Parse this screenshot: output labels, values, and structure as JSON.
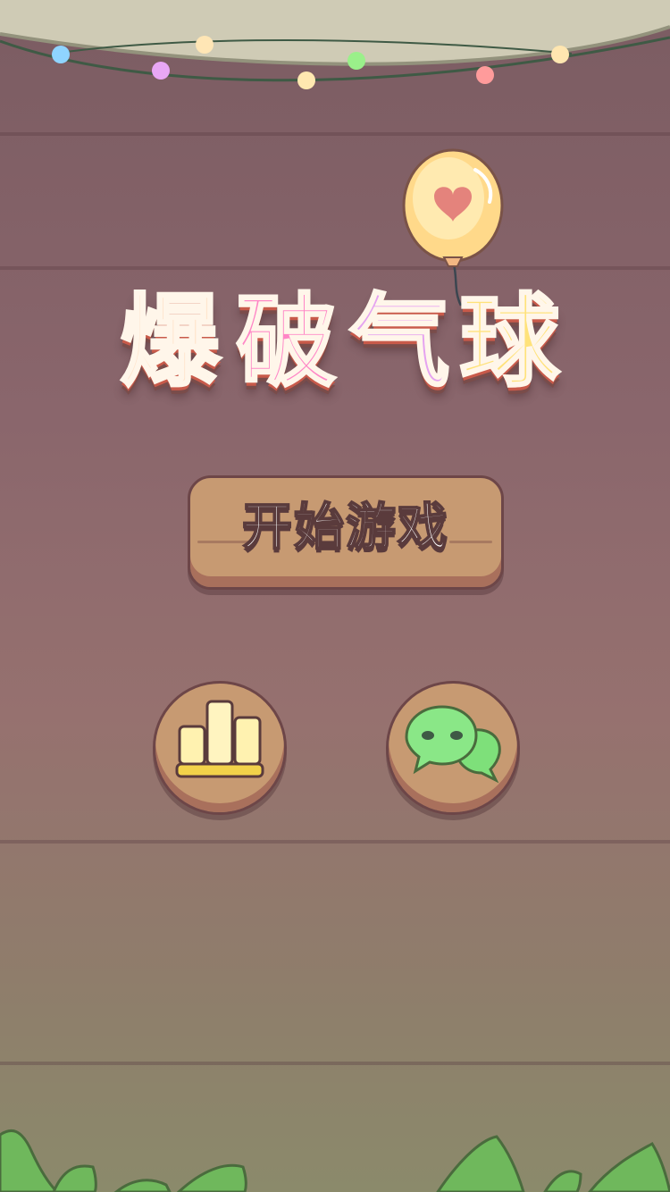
{
  "game": {
    "title_chars": [
      "爆",
      "破",
      "气",
      "球"
    ],
    "title_colors": [
      "#ffe6cf",
      "#ff86c6",
      "#e5a3f0",
      "#ffe27a"
    ],
    "start_button_label": "开始游戏"
  },
  "buttons": {
    "leaderboard_icon": "leaderboard-icon",
    "wechat_icon": "wechat-icon"
  },
  "theme": {
    "wood": "#c79a72",
    "outline": "#6d4648",
    "background": "#8a666c",
    "grass": "#6fb85c"
  }
}
